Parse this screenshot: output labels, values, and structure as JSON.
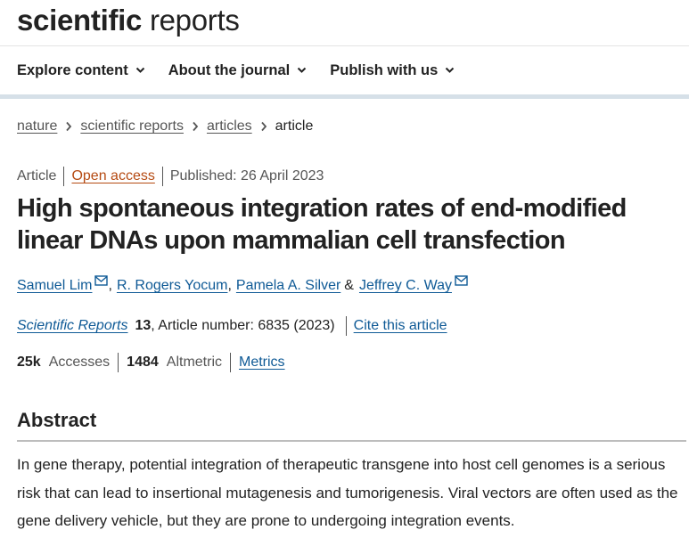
{
  "header": {
    "logo_bold": "scientific",
    "logo_light": "reports"
  },
  "nav": {
    "items": [
      {
        "label": "Explore content",
        "icon": "chevron-down-icon"
      },
      {
        "label": "About the journal",
        "icon": "chevron-down-icon"
      },
      {
        "label": "Publish with us",
        "icon": "chevron-down-icon"
      }
    ]
  },
  "breadcrumb": {
    "items": [
      "nature",
      "scientific reports",
      "articles"
    ],
    "current": "article",
    "separator_icon": "chevron-right-icon"
  },
  "meta": {
    "type": "Article",
    "access": "Open access",
    "published": "Published: 26 April 2023"
  },
  "article": {
    "title": "High spontaneous integration rates of end-modified linear DNAs upon mammalian cell transfection"
  },
  "authors": {
    "list": [
      {
        "name": "Samuel Lim",
        "has_email": true
      },
      {
        "name": "R. Rogers Yocum",
        "has_email": false
      },
      {
        "name": "Pamela A. Silver",
        "has_email": false
      },
      {
        "name": "Jeffrey C. Way",
        "has_email": true
      }
    ],
    "comma": ",",
    "ampersand": "&",
    "email_icon": "envelope-icon"
  },
  "citation": {
    "journal": "Scientific Reports",
    "volume": "13",
    "details": ", Article number: 6835 (2023)",
    "cite_link": "Cite this article"
  },
  "metrics": {
    "accesses_value": "25k",
    "accesses_label": "Accesses",
    "altmetric_value": "1484",
    "altmetric_label": "Altmetric",
    "metrics_link": "Metrics"
  },
  "abstract": {
    "heading": "Abstract",
    "text": "In gene therapy, potential integration of therapeutic transgene into host cell genomes is a serious risk that can lead to insertional mutagenesis and tumorigenesis. Viral vectors are often used as the gene delivery vehicle, but they are prone to undergoing integration events."
  },
  "colors": {
    "link": "#0f5a96",
    "open_access": "#b54a12",
    "nav_band": "#d6e0e8",
    "text": "#222222",
    "muted": "#555555"
  }
}
